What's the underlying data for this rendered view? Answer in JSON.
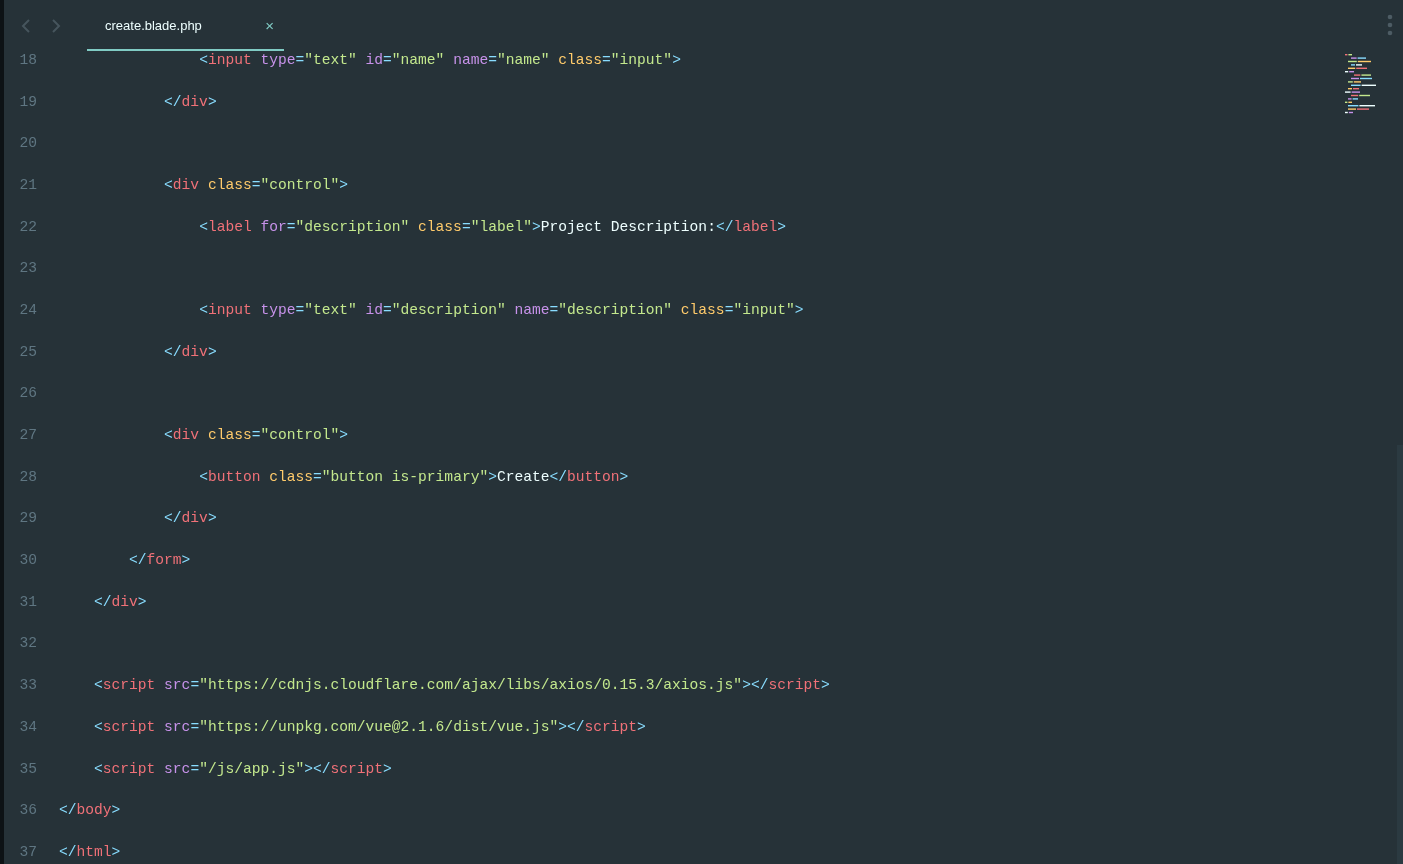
{
  "tab": {
    "title": "create.blade.php",
    "close": "×",
    "selected": true
  },
  "lines": [
    {
      "number": "18",
      "tokens": [
        {
          "kind": "punct",
          "text": "                <"
        },
        {
          "kind": "tag",
          "text": "input "
        },
        {
          "kind": "attr",
          "text": "type"
        },
        {
          "kind": "eq",
          "text": "="
        },
        {
          "kind": "string",
          "text": "\"text\" "
        },
        {
          "kind": "attr",
          "text": "id"
        },
        {
          "kind": "eq",
          "text": "="
        },
        {
          "kind": "string",
          "text": "\"name\" "
        },
        {
          "kind": "attr",
          "text": "name"
        },
        {
          "kind": "eq",
          "text": "="
        },
        {
          "kind": "string",
          "text": "\"name\" "
        },
        {
          "kind": "attr2",
          "text": "class"
        },
        {
          "kind": "eq",
          "text": "="
        },
        {
          "kind": "string",
          "text": "\"input\""
        },
        {
          "kind": "punct",
          "text": ">"
        }
      ]
    },
    {
      "number": "19",
      "tokens": [
        {
          "kind": "punct",
          "text": "            </"
        },
        {
          "kind": "tag",
          "text": "div"
        },
        {
          "kind": "punct",
          "text": ">"
        }
      ]
    },
    {
      "number": "20"
    },
    {
      "number": "21",
      "tokens": [
        {
          "kind": "punct",
          "text": "            <"
        },
        {
          "kind": "tag",
          "text": "div "
        },
        {
          "kind": "attr2",
          "text": "class"
        },
        {
          "kind": "eq",
          "text": "="
        },
        {
          "kind": "string",
          "text": "\"control\""
        },
        {
          "kind": "punct",
          "text": ">"
        }
      ]
    },
    {
      "number": "22",
      "tokens": [
        {
          "kind": "punct",
          "text": "                <"
        },
        {
          "kind": "tag",
          "text": "label "
        },
        {
          "kind": "attr",
          "text": "for"
        },
        {
          "kind": "eq",
          "text": "="
        },
        {
          "kind": "string",
          "text": "\"description\" "
        },
        {
          "kind": "attr2",
          "text": "class"
        },
        {
          "kind": "eq",
          "text": "="
        },
        {
          "kind": "string",
          "text": "\"label\""
        },
        {
          "kind": "punct",
          "text": ">"
        },
        {
          "kind": "text",
          "text": "Project Description:"
        },
        {
          "kind": "punct",
          "text": "</"
        },
        {
          "kind": "tag",
          "text": "label"
        },
        {
          "kind": "punct",
          "text": ">"
        }
      ]
    },
    {
      "number": "23"
    },
    {
      "number": "24",
      "tokens": [
        {
          "kind": "punct",
          "text": "                <"
        },
        {
          "kind": "tag",
          "text": "input "
        },
        {
          "kind": "attr",
          "text": "type"
        },
        {
          "kind": "eq",
          "text": "="
        },
        {
          "kind": "string",
          "text": "\"text\" "
        },
        {
          "kind": "attr",
          "text": "id"
        },
        {
          "kind": "eq",
          "text": "="
        },
        {
          "kind": "string",
          "text": "\"description\" "
        },
        {
          "kind": "attr",
          "text": "name"
        },
        {
          "kind": "eq",
          "text": "="
        },
        {
          "kind": "string",
          "text": "\"description\" "
        },
        {
          "kind": "attr2",
          "text": "class"
        },
        {
          "kind": "eq",
          "text": "="
        },
        {
          "kind": "string",
          "text": "\"input\""
        },
        {
          "kind": "punct",
          "text": ">"
        }
      ]
    },
    {
      "number": "25",
      "tokens": [
        {
          "kind": "punct",
          "text": "            </"
        },
        {
          "kind": "tag",
          "text": "div"
        },
        {
          "kind": "punct",
          "text": ">"
        }
      ]
    },
    {
      "number": "26"
    },
    {
      "number": "27",
      "tokens": [
        {
          "kind": "punct",
          "text": "            <"
        },
        {
          "kind": "tag",
          "text": "div "
        },
        {
          "kind": "attr2",
          "text": "class"
        },
        {
          "kind": "eq",
          "text": "="
        },
        {
          "kind": "string",
          "text": "\"control\""
        },
        {
          "kind": "punct",
          "text": ">"
        }
      ]
    },
    {
      "number": "28",
      "tokens": [
        {
          "kind": "punct",
          "text": "                <"
        },
        {
          "kind": "tag",
          "text": "button "
        },
        {
          "kind": "attr2",
          "text": "class"
        },
        {
          "kind": "eq",
          "text": "="
        },
        {
          "kind": "string",
          "text": "\"button is-primary\""
        },
        {
          "kind": "punct",
          "text": ">"
        },
        {
          "kind": "text",
          "text": "Create"
        },
        {
          "kind": "punct",
          "text": "</"
        },
        {
          "kind": "tag",
          "text": "button"
        },
        {
          "kind": "punct",
          "text": ">"
        }
      ]
    },
    {
      "number": "29",
      "tokens": [
        {
          "kind": "punct",
          "text": "            </"
        },
        {
          "kind": "tag",
          "text": "div"
        },
        {
          "kind": "punct",
          "text": ">"
        }
      ]
    },
    {
      "number": "30",
      "tokens": [
        {
          "kind": "punct",
          "text": "        </"
        },
        {
          "kind": "tag",
          "text": "form"
        },
        {
          "kind": "punct",
          "text": ">"
        }
      ]
    },
    {
      "number": "31",
      "tokens": [
        {
          "kind": "punct",
          "text": "    </"
        },
        {
          "kind": "tag",
          "text": "div"
        },
        {
          "kind": "punct",
          "text": ">"
        }
      ]
    },
    {
      "number": "32"
    },
    {
      "number": "33",
      "tokens": [
        {
          "kind": "punct",
          "text": "    <"
        },
        {
          "kind": "tag",
          "text": "script "
        },
        {
          "kind": "attr",
          "text": "src"
        },
        {
          "kind": "eq",
          "text": "="
        },
        {
          "kind": "string",
          "text": "\"https://cdnjs.cloudflare.com/ajax/libs/axios/0.15.3/axios.js\""
        },
        {
          "kind": "punct",
          "text": "></"
        },
        {
          "kind": "tag",
          "text": "script"
        },
        {
          "kind": "punct",
          "text": ">"
        }
      ]
    },
    {
      "number": "34",
      "tokens": [
        {
          "kind": "punct",
          "text": "    <"
        },
        {
          "kind": "tag",
          "text": "script "
        },
        {
          "kind": "attr",
          "text": "src"
        },
        {
          "kind": "eq",
          "text": "="
        },
        {
          "kind": "string",
          "text": "\"https://unpkg.com/vue@2.1.6/dist/vue.js\""
        },
        {
          "kind": "punct",
          "text": "></"
        },
        {
          "kind": "tag",
          "text": "script"
        },
        {
          "kind": "punct",
          "text": ">"
        }
      ]
    },
    {
      "number": "35",
      "tokens": [
        {
          "kind": "punct",
          "text": "    <"
        },
        {
          "kind": "tag",
          "text": "script "
        },
        {
          "kind": "attr",
          "text": "src"
        },
        {
          "kind": "eq",
          "text": "="
        },
        {
          "kind": "string",
          "text": "\"/js/app.js\""
        },
        {
          "kind": "punct",
          "text": "></"
        },
        {
          "kind": "tag",
          "text": "script"
        },
        {
          "kind": "punct",
          "text": ">"
        }
      ]
    },
    {
      "number": "36",
      "tokens": [
        {
          "kind": "punct",
          "text": "</"
        },
        {
          "kind": "tag",
          "text": "body"
        },
        {
          "kind": "punct",
          "text": ">"
        }
      ]
    },
    {
      "number": "37",
      "tokens": [
        {
          "kind": "punct",
          "text": "</"
        },
        {
          "kind": "tag",
          "text": "html"
        },
        {
          "kind": "punct",
          "text": ">"
        }
      ]
    }
  ]
}
